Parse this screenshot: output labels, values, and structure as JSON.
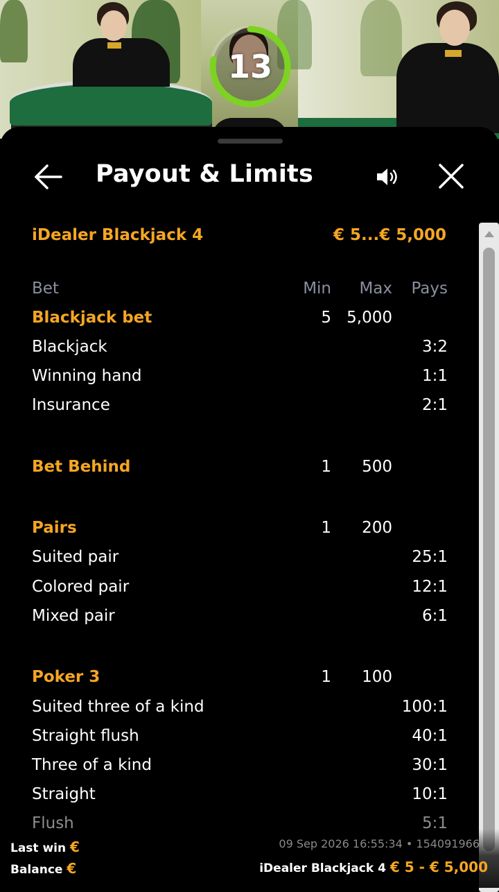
{
  "timer": {
    "value": "13",
    "progress": 0.78,
    "color": "#7dd321"
  },
  "header": {
    "title": "Payout & Limits",
    "back_icon": "arrow-left-icon",
    "sound_icon": "speaker-icon",
    "close_icon": "close-icon"
  },
  "game": {
    "name": "iDealer Blackjack 4",
    "range": "€ 5...€ 5,000"
  },
  "columns": {
    "bet": "Bet",
    "min": "Min",
    "max": "Max",
    "pays": "Pays"
  },
  "rows": [
    {
      "type": "cat",
      "name": "Blackjack bet",
      "min": "5",
      "max": "5,000",
      "pays": ""
    },
    {
      "type": "item",
      "name": "Blackjack",
      "min": "",
      "max": "",
      "pays": "3:2"
    },
    {
      "type": "item",
      "name": "Winning hand",
      "min": "",
      "max": "",
      "pays": "1:1"
    },
    {
      "type": "item",
      "name": "Insurance",
      "min": "",
      "max": "",
      "pays": "2:1"
    },
    {
      "type": "cat",
      "name": "Bet Behind",
      "min": "1",
      "max": "500",
      "pays": ""
    },
    {
      "type": "cat",
      "name": "Pairs",
      "min": "1",
      "max": "200",
      "pays": ""
    },
    {
      "type": "item",
      "name": "Suited pair",
      "min": "",
      "max": "",
      "pays": "25:1"
    },
    {
      "type": "item",
      "name": "Colored pair",
      "min": "",
      "max": "",
      "pays": "12:1"
    },
    {
      "type": "item",
      "name": "Mixed pair",
      "min": "",
      "max": "",
      "pays": "6:1"
    },
    {
      "type": "cat",
      "name": "Poker 3",
      "min": "1",
      "max": "100",
      "pays": ""
    },
    {
      "type": "item",
      "name": "Suited three of a kind",
      "min": "",
      "max": "",
      "pays": "100:1"
    },
    {
      "type": "item",
      "name": "Straight flush",
      "min": "",
      "max": "",
      "pays": "40:1"
    },
    {
      "type": "item",
      "name": "Three of a kind",
      "min": "",
      "max": "",
      "pays": "30:1"
    },
    {
      "type": "item",
      "name": "Straight",
      "min": "",
      "max": "",
      "pays": "10:1"
    },
    {
      "type": "item",
      "name": "Flush",
      "min": "",
      "max": "",
      "pays": "5:1"
    }
  ],
  "footer": {
    "last_win_label": "Last win",
    "balance_label": "Balance",
    "currency": "€",
    "timestamp": "09 Sep 2026 16:55:34 • 154091966",
    "game_name": "iDealer Blackjack 4",
    "limits": "€ 5 - € 5,000"
  },
  "colors": {
    "accent": "#f5a623",
    "header_text": "#8a8f9e",
    "background": "#000000"
  }
}
